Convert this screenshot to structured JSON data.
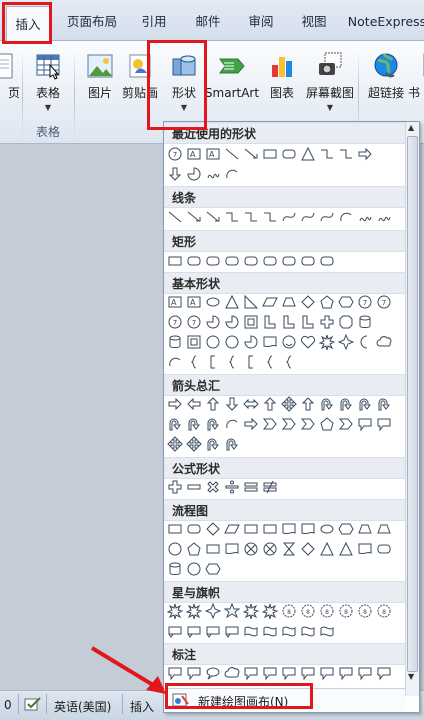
{
  "tabs": [
    {
      "label": "插入",
      "active": true
    },
    {
      "label": "页面布局"
    },
    {
      "label": "引用"
    },
    {
      "label": "邮件"
    },
    {
      "label": "审阅"
    },
    {
      "label": "视图"
    },
    {
      "label": "NoteExpress"
    }
  ],
  "ribbon": {
    "buttons": [
      {
        "label": "页"
      },
      {
        "label": "表格"
      },
      {
        "label": "图片"
      },
      {
        "label": "剪贴画"
      },
      {
        "label": "形状"
      },
      {
        "label": "SmartArt"
      },
      {
        "label": "图表"
      },
      {
        "label": "屏幕截图"
      },
      {
        "label": "超链接"
      },
      {
        "label": "书"
      }
    ],
    "group_label": "表格"
  },
  "gallery": {
    "categories": [
      {
        "title": "最近使用的形状"
      },
      {
        "title": "线条"
      },
      {
        "title": "矩形"
      },
      {
        "title": "基本形状"
      },
      {
        "title": "箭头总汇"
      },
      {
        "title": "公式形状"
      },
      {
        "title": "流程图"
      },
      {
        "title": "星与旗帜"
      },
      {
        "title": "标注"
      }
    ],
    "new_canvas_label": "新建绘图画布(N)"
  },
  "statusbar": {
    "page_num": "0",
    "language": "英语(美国)",
    "mode": "插入"
  },
  "colors": {
    "highlight": "#e0171d",
    "accent": "#2b579a"
  }
}
